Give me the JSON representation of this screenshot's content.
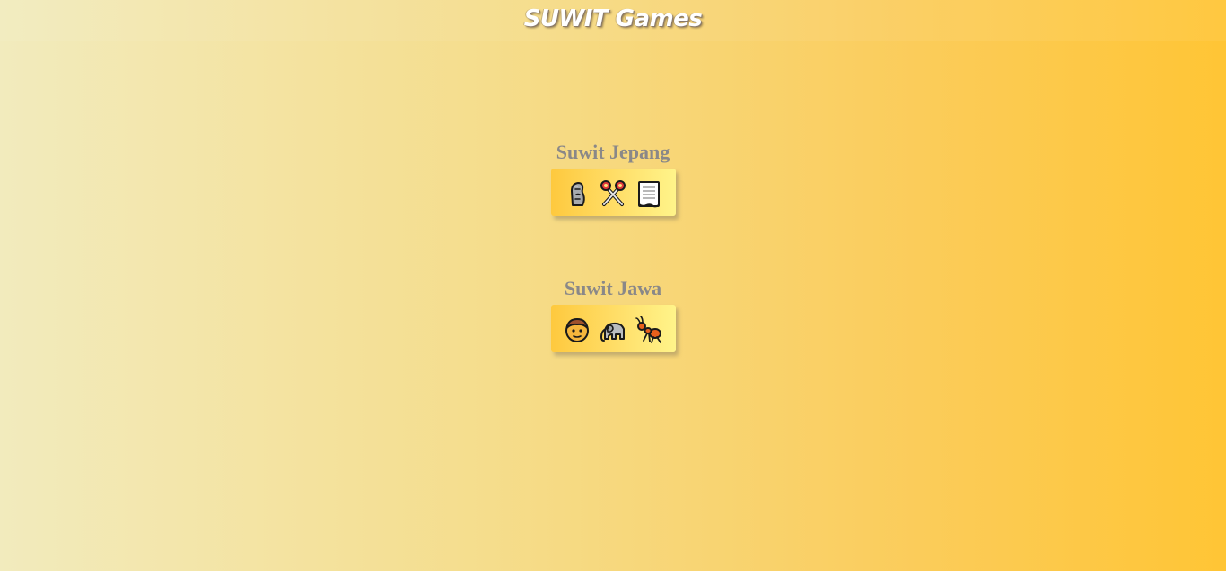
{
  "header": {
    "title": "SUWIT Games"
  },
  "games": [
    {
      "title": "Suwit Jepang",
      "choices": [
        "rock-icon",
        "scissors-icon",
        "paper-icon"
      ]
    },
    {
      "title": "Suwit Jawa",
      "choices": [
        "person-icon",
        "elephant-icon",
        "ant-icon"
      ]
    }
  ],
  "colors": {
    "background_left": "#f2ebbd",
    "background_right": "#ffc535",
    "game_title": "#8a8888",
    "button_left": "#fec93e",
    "button_right": "#fff48a"
  }
}
